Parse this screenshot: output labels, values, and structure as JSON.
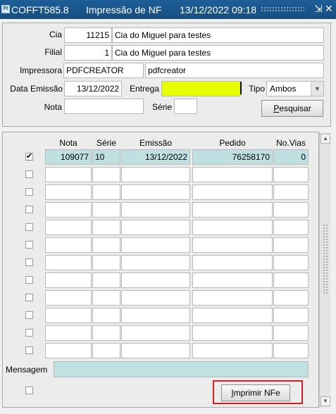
{
  "titlebar": {
    "module": "COFFT585.8",
    "title": "Impressão de NF",
    "datetime": "13/12/2022 09:18",
    "ctl_minimize": "⇲",
    "ctl_close": "✕"
  },
  "form": {
    "cia_label": "Cia",
    "cia_code": "11215",
    "cia_name": "Cia do Miguel para testes",
    "filial_label": "Filial",
    "filial_code": "1",
    "filial_name": "Cia do Miguel para testes",
    "impressora_label": "Impressora",
    "impressora_value": "PDFCREATOR",
    "impressora_desc": "pdfcreator",
    "data_emissao_label": "Data Emissão",
    "data_emissao_value": "13/12/2022",
    "entrega_label": "Entrega",
    "entrega_value": "",
    "tipo_label": "Tipo",
    "tipo_value": "Ambos",
    "nota_label": "Nota",
    "nota_value": "",
    "serie_label": "Série",
    "serie_value": "",
    "pesquisar_label": "Pesquisar",
    "pesquisar_mnemonic": "P",
    "pesquisar_rest": "esquisar"
  },
  "grid": {
    "headers": [
      "Nota",
      "Série",
      "Emissão",
      "Pedido",
      "No.Vias"
    ],
    "rows": [
      {
        "checked": true,
        "nota": "109077",
        "serie": "10",
        "emissao": "13/12/2022",
        "pedido": "76258170",
        "vias": "0"
      },
      {
        "checked": false,
        "nota": "",
        "serie": "",
        "emissao": "",
        "pedido": "",
        "vias": ""
      },
      {
        "checked": false,
        "nota": "",
        "serie": "",
        "emissao": "",
        "pedido": "",
        "vias": ""
      },
      {
        "checked": false,
        "nota": "",
        "serie": "",
        "emissao": "",
        "pedido": "",
        "vias": ""
      },
      {
        "checked": false,
        "nota": "",
        "serie": "",
        "emissao": "",
        "pedido": "",
        "vias": ""
      },
      {
        "checked": false,
        "nota": "",
        "serie": "",
        "emissao": "",
        "pedido": "",
        "vias": ""
      },
      {
        "checked": false,
        "nota": "",
        "serie": "",
        "emissao": "",
        "pedido": "",
        "vias": ""
      },
      {
        "checked": false,
        "nota": "",
        "serie": "",
        "emissao": "",
        "pedido": "",
        "vias": ""
      },
      {
        "checked": false,
        "nota": "",
        "serie": "",
        "emissao": "",
        "pedido": "",
        "vias": ""
      },
      {
        "checked": false,
        "nota": "",
        "serie": "",
        "emissao": "",
        "pedido": "",
        "vias": ""
      },
      {
        "checked": false,
        "nota": "",
        "serie": "",
        "emissao": "",
        "pedido": "",
        "vias": ""
      },
      {
        "checked": false,
        "nota": "",
        "serie": "",
        "emissao": "",
        "pedido": "",
        "vias": ""
      }
    ],
    "check_mark": "✔"
  },
  "bottom": {
    "mensagem_label": "Mensagem",
    "mensagem_value": "",
    "imprimir_label": "Imprimir NFe",
    "imprimir_mnemonic": "I",
    "imprimir_rest": "mprimir NFe"
  },
  "colors": {
    "titlebar": "#174e80",
    "highlight_yellow": "#e5ff00",
    "selected_row": "#bfe0e0",
    "annotation_red": "#d81e1e"
  }
}
